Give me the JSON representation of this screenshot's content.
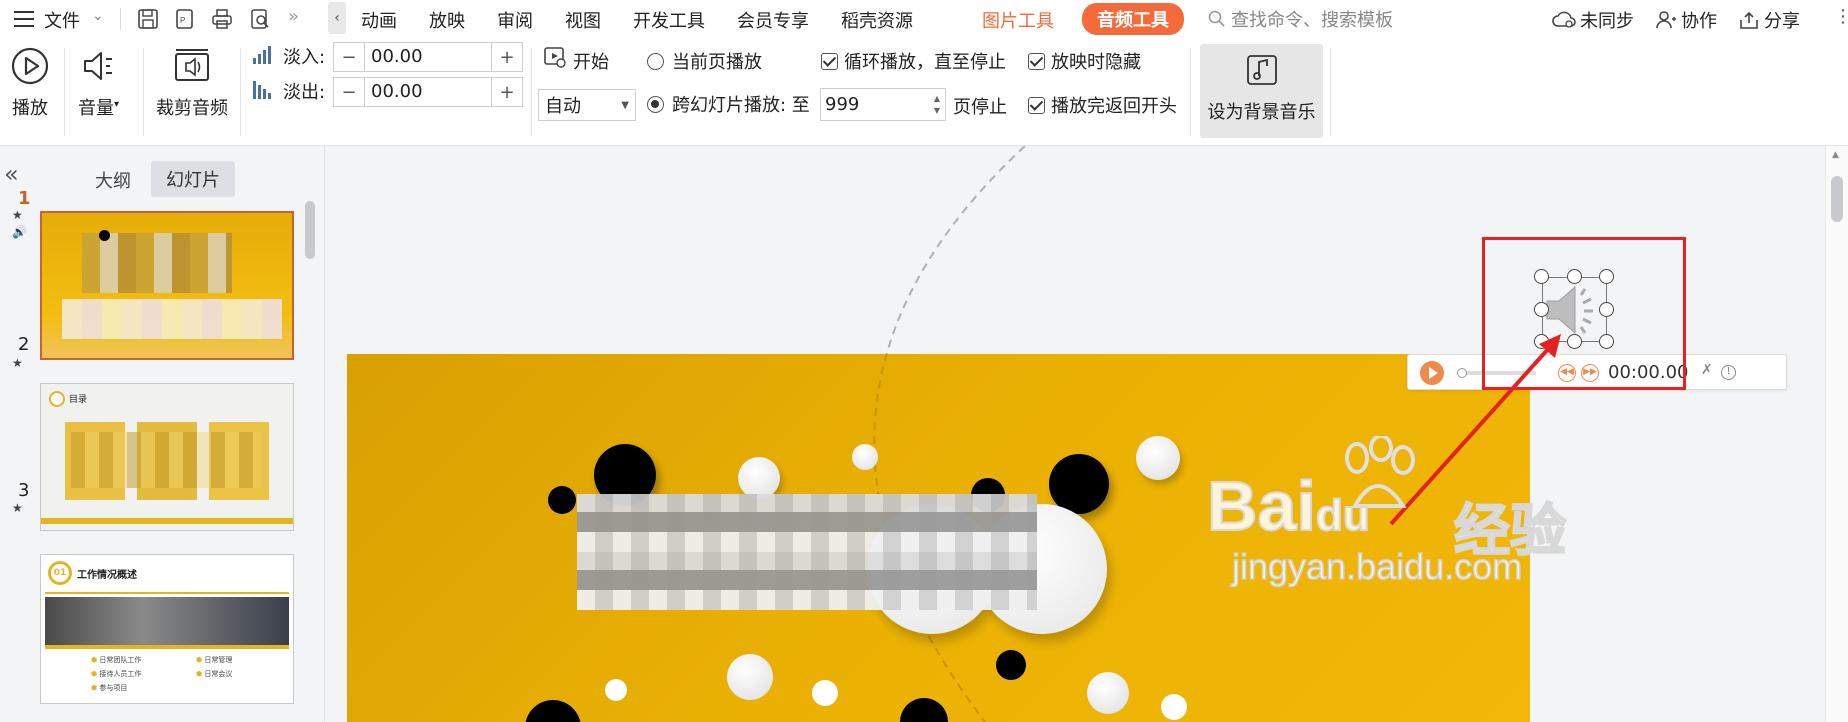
{
  "menubar": {
    "file_label": "文件",
    "items": [
      "动画",
      "放映",
      "审阅",
      "视图",
      "开发工具",
      "会员专享",
      "稻壳资源"
    ],
    "context_tab_picture": "图片工具",
    "context_tab_audio": "音频工具",
    "search_placeholder": "查找命令、搜索模板",
    "sync_label": "未同步",
    "collab_label": "协作",
    "share_label": "分享"
  },
  "ribbon": {
    "play_label": "播放",
    "volume_label": "音量",
    "trim_label": "裁剪音频",
    "fade_in_label": "淡入:",
    "fade_in_value": "00.00",
    "fade_out_label": "淡出:",
    "fade_out_value": "00.00",
    "start_label": "开始",
    "start_select_value": "自动",
    "current_page_label": "当前页播放",
    "cross_slide_label": "跨幻灯片播放: 至",
    "page_stop_value": "999",
    "page_stop_label": "页停止",
    "loop_label": "循环播放，直至停止",
    "hide_label": "放映时隐藏",
    "rewind_label": "播放完返回开头",
    "bg_music_label": "设为背景音乐"
  },
  "panel": {
    "tab_outline": "大纲",
    "tab_slides": "幻灯片",
    "slides": [
      {
        "num": "1",
        "title": ""
      },
      {
        "num": "2",
        "title": "目录"
      },
      {
        "num": "3",
        "title": "工作情况概述"
      }
    ],
    "thumb3_items": [
      "日常团队工作",
      "日常管理",
      "接待人员工作",
      "日常会议",
      "参与项目"
    ]
  },
  "audio": {
    "time": "00:00.00"
  },
  "watermark": {
    "brand": "Bai",
    "brand2": "du",
    "cn": "经验",
    "url": "jingyan.baidu.com"
  },
  "colors": {
    "accent_orange": "#f46a3a",
    "slide_yellow": "#e9b106",
    "highlight_red": "#e52222",
    "selected_border": "#c8622f"
  }
}
